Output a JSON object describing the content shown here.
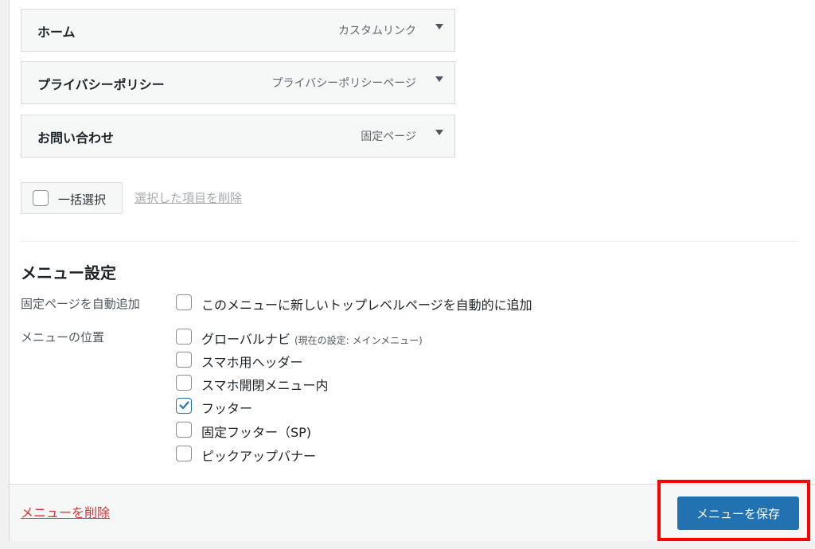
{
  "menu_items": [
    {
      "title": "ホーム",
      "type": "カスタムリンク"
    },
    {
      "title": "プライバシーポリシー",
      "type": "プライバシーポリシーページ"
    },
    {
      "title": "お問い合わせ",
      "type": "固定ページ"
    }
  ],
  "bulk": {
    "select_label": "一括選択",
    "delete_selected": "選択した項目を削除"
  },
  "settings": {
    "title": "メニュー設定",
    "auto_add_label": "固定ページを自動追加",
    "auto_add_option": "このメニューに新しいトップレベルページを自動的に追加",
    "location_label": "メニューの位置",
    "locations": [
      {
        "label": "グローバルナビ",
        "note": "(現在の設定: メインメニュー)",
        "checked": false
      },
      {
        "label": "スマホ用ヘッダー",
        "note": "",
        "checked": false
      },
      {
        "label": "スマホ開閉メニュー内",
        "note": "",
        "checked": false
      },
      {
        "label": "フッター",
        "note": "",
        "checked": true
      },
      {
        "label": "固定フッター（SP)",
        "note": "",
        "checked": false
      },
      {
        "label": "ピックアップバナー",
        "note": "",
        "checked": false
      }
    ]
  },
  "footer": {
    "delete_menu": "メニューを削除",
    "save": "メニューを保存"
  },
  "colors": {
    "primary": "#2271b1",
    "danger": "#d63638",
    "highlight": "#ff0000"
  }
}
